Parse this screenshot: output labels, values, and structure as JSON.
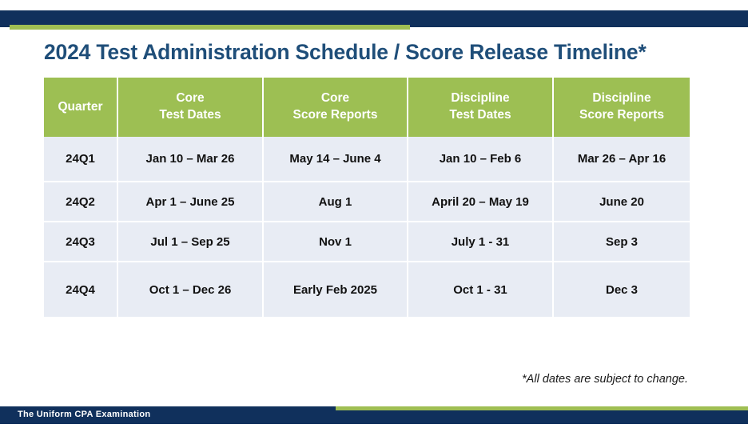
{
  "slide": {
    "title": "2024 Test Administration Schedule / Score Release Timeline*",
    "footnote": "*All dates are subject to change.",
    "footer_text": "The Uniform CPA Examination"
  },
  "colors": {
    "navy": "#10305c",
    "green": "#9fbe53",
    "header_green": "#9dbf53",
    "title_blue": "#1f4e79",
    "cell_bg": "#e8ecf4"
  },
  "table": {
    "headers": [
      {
        "line1": "Quarter",
        "line2": ""
      },
      {
        "line1": "Core",
        "line2": "Test Dates"
      },
      {
        "line1": "Core",
        "line2": "Score Reports"
      },
      {
        "line1": "Discipline",
        "line2": "Test Dates"
      },
      {
        "line1": "Discipline",
        "line2": "Score Reports"
      }
    ],
    "rows": [
      {
        "quarter": "24Q1",
        "core_test_dates": "Jan 10 – Mar 26",
        "core_score_reports": "May 14 – June 4",
        "discipline_test_dates": "Jan 10 – Feb 6",
        "discipline_score_reports": "Mar 26 – Apr 16"
      },
      {
        "quarter": "24Q2",
        "core_test_dates": "Apr 1 – June 25",
        "core_score_reports": "Aug 1",
        "discipline_test_dates": "April 20  – May 19",
        "discipline_score_reports": "June 20"
      },
      {
        "quarter": "24Q3",
        "core_test_dates": "Jul 1 – Sep 25",
        "core_score_reports": "Nov 1",
        "discipline_test_dates": "July 1  - 31",
        "discipline_score_reports": "Sep 3"
      },
      {
        "quarter": "24Q4",
        "core_test_dates": "Oct 1 – Dec 26",
        "core_score_reports": "Early Feb 2025",
        "discipline_test_dates": "Oct 1 - 31",
        "discipline_score_reports": "Dec 3"
      }
    ]
  }
}
